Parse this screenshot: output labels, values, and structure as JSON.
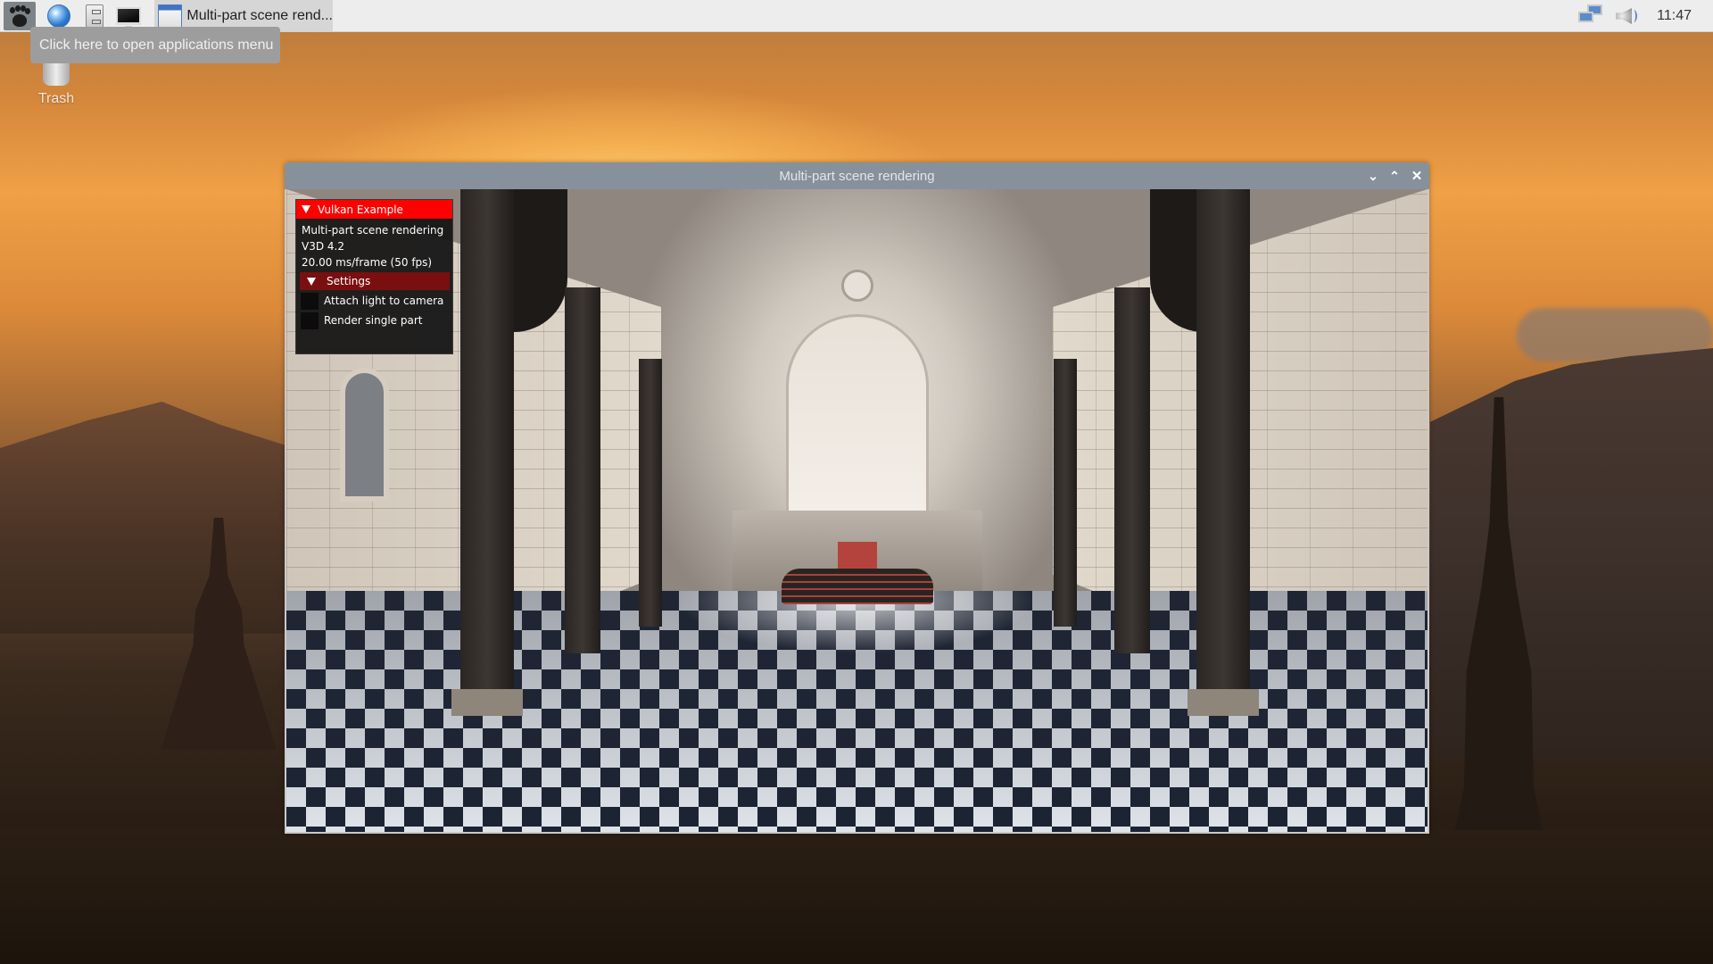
{
  "taskbar": {
    "launchers": [
      {
        "name": "applications-menu",
        "icon": "gnome-foot-icon"
      },
      {
        "name": "web-browser",
        "icon": "globe-icon"
      },
      {
        "name": "file-manager",
        "icon": "file-cabinet-icon"
      },
      {
        "name": "terminal",
        "icon": "monitor-icon"
      }
    ],
    "task_button": {
      "label": "Multi-part scene rend...",
      "icon": "window-icon"
    },
    "tray": {
      "network_icon": "network-icon",
      "volume_icon": "speaker-icon",
      "clock": "11:47"
    }
  },
  "tooltip": {
    "text": "Click here to open applications menu"
  },
  "desktop": {
    "icons": [
      {
        "label": "Trash",
        "icon": "trash-icon"
      }
    ]
  },
  "window": {
    "title": "Multi-part scene rendering",
    "controls": {
      "minimize": "⌄",
      "maximize": "⌃",
      "close": "✕"
    },
    "overlay": {
      "header": "Vulkan Example",
      "lines": [
        "Multi-part scene rendering",
        "V3D 4.2",
        "20.00 ms/frame (50 fps)"
      ],
      "settings": {
        "label": "Settings",
        "checkboxes": [
          {
            "label": "Attach light to camera",
            "checked": false
          },
          {
            "label": "Render single part",
            "checked": false
          }
        ]
      }
    },
    "colors": {
      "header": "#ff0000",
      "settings_header": "#7a0f0f",
      "titlebar": "#87919b"
    }
  }
}
